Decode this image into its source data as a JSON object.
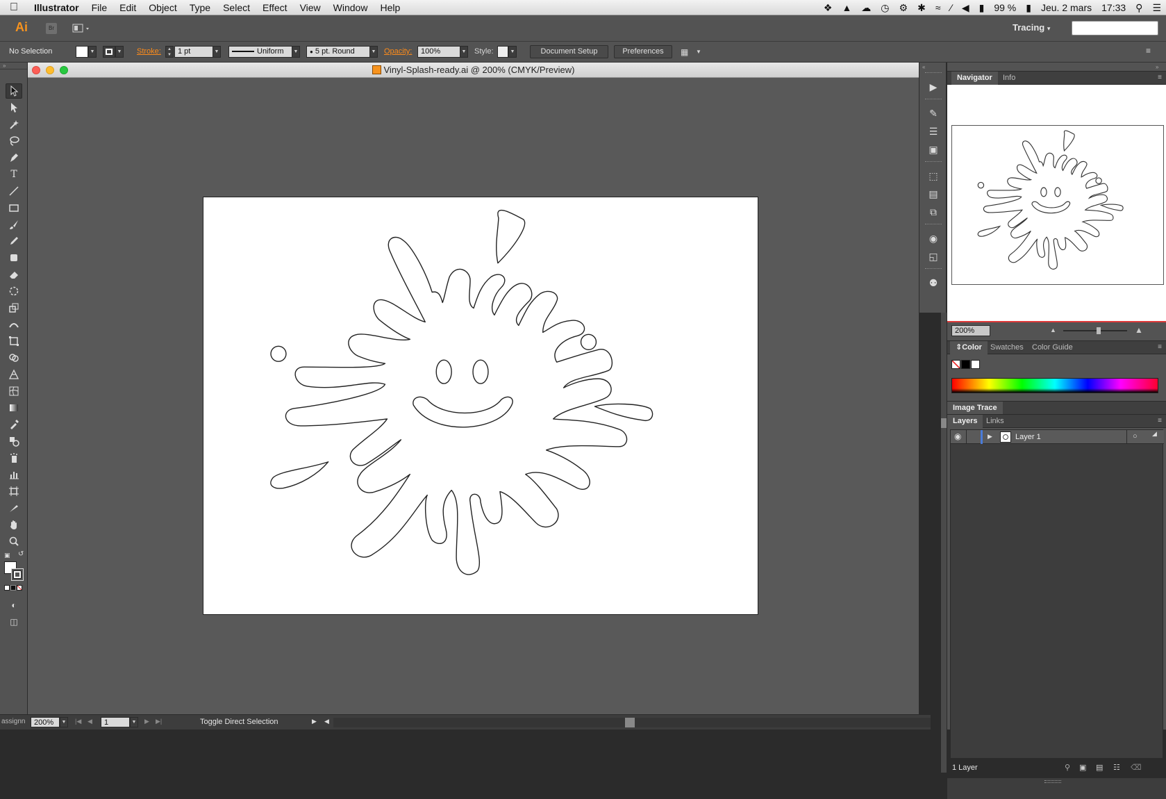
{
  "menubar": {
    "app": "Illustrator",
    "items": [
      "File",
      "Edit",
      "Object",
      "Type",
      "Select",
      "Effect",
      "View",
      "Window",
      "Help"
    ],
    "battery": "99 %",
    "date": "Jeu. 2 mars",
    "time": "17:33"
  },
  "appbar": {
    "logo": "Ai",
    "bridge": "Br",
    "workspace": "Tracing"
  },
  "control": {
    "selection": "No Selection",
    "stroke_label": "Stroke:",
    "stroke_value": "1 pt",
    "profile": "Uniform",
    "brush": "5 pt. Round",
    "opacity_label": "Opacity:",
    "opacity_value": "100%",
    "style_label": "Style:",
    "doc_setup": "Document Setup",
    "preferences": "Preferences"
  },
  "document": {
    "title": "Vinyl-Splash-ready.ai @ 200% (CMYK/Preview)"
  },
  "status": {
    "zoom": "200%",
    "page": "1",
    "message": "Toggle Direct Selection",
    "left_clip": "assignn"
  },
  "navigator": {
    "tabs": [
      "Navigator",
      "Info"
    ],
    "zoom": "200%"
  },
  "color": {
    "tabs": [
      "Color",
      "Swatches",
      "Color Guide"
    ]
  },
  "image_trace": {
    "title": "Image Trace"
  },
  "layers": {
    "tabs": [
      "Layers",
      "Links"
    ],
    "layer_name": "Layer 1",
    "count": "1 Layer"
  },
  "colors": {
    "accent": "#f7931e",
    "stroke_label": "#ff8c1a",
    "nav_red": "#e03a3a",
    "layer_blue": "#4a7bd8"
  }
}
